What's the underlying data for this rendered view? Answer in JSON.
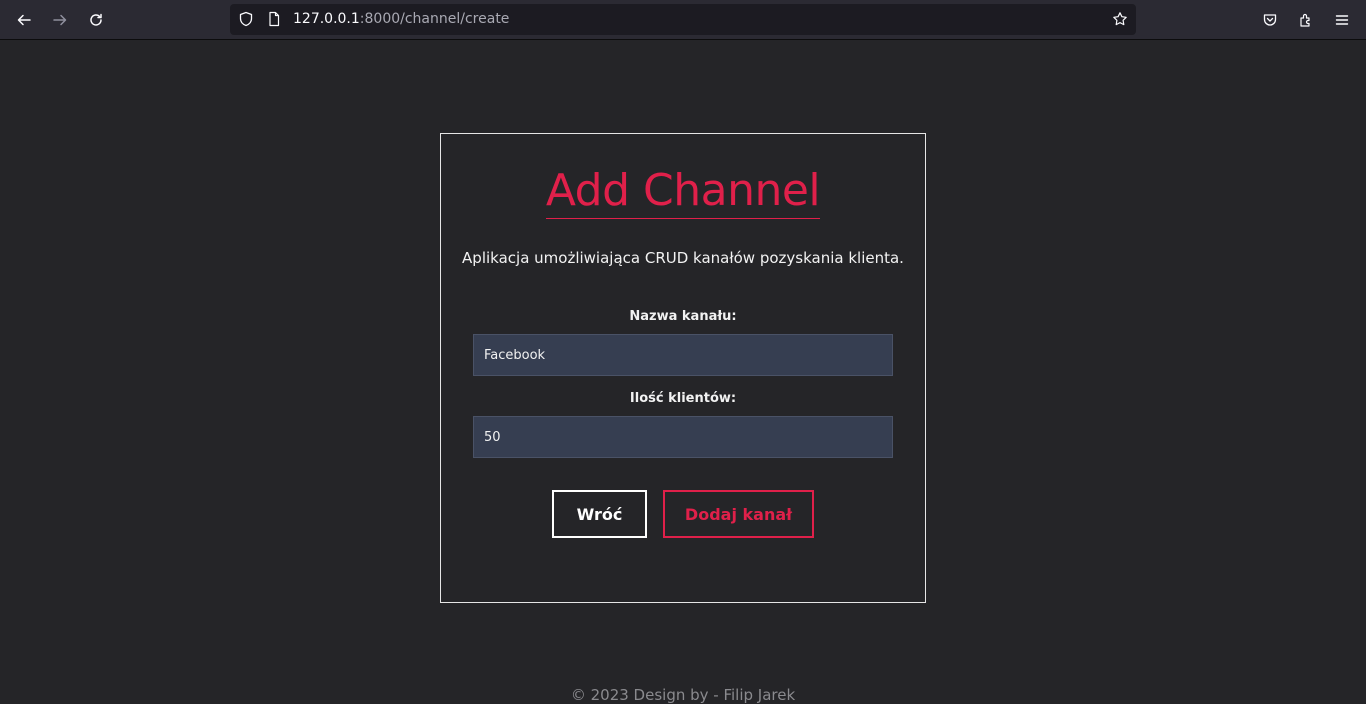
{
  "browser": {
    "url_host": "127.0.0.1",
    "url_rest": ":8000/channel/create",
    "icons": [
      "back-arrow-icon",
      "forward-arrow-icon",
      "reload-icon",
      "shield-icon",
      "page-icon",
      "star-icon",
      "pocket-icon",
      "extensions-icon",
      "menu-icon"
    ]
  },
  "card": {
    "title": "Add Channel",
    "subtitle": "Aplikacja umożliwiająca CRUD kanałów pozyskania klienta.",
    "fields": {
      "name_label": "Nazwa kanału:",
      "name_value": "Facebook",
      "clients_label": "Ilość klientów:",
      "clients_value": "50"
    },
    "buttons": {
      "back_label": "Wróć",
      "add_label": "Dodaj kanał"
    }
  },
  "footer": {
    "text": "© 2023 Design by - Filip Jarek"
  },
  "colors": {
    "accent": "#e0204a",
    "background": "#252528",
    "input_bg": "#363e51"
  }
}
